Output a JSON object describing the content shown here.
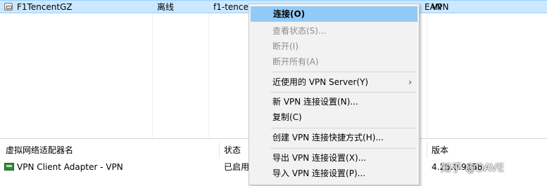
{
  "connection_list": {
    "row": {
      "name": "F1TencentGZ",
      "status": "离线",
      "server": "f1-tence",
      "server_tail": "EAN",
      "type": "VPN"
    }
  },
  "context_menu": {
    "items": [
      {
        "label": "连接(O)",
        "state": "highlighted"
      },
      {
        "label": "查看状态(S)...",
        "state": "disabled"
      },
      {
        "label": "断开(I)",
        "state": "disabled"
      },
      {
        "label": "断开所有(A)",
        "state": "disabled"
      },
      {
        "label": "近使用的 VPN Server(Y)",
        "submenu_arrow": "›"
      },
      {
        "label": "新 VPN 连接设置(N)..."
      },
      {
        "label": "复制(C)"
      },
      {
        "label": "创建 VPN 连接快捷方式(H)..."
      },
      {
        "label": "导出 VPN 连接设置(X)..."
      },
      {
        "label": "导入 VPN 连接设置(P)..."
      }
    ]
  },
  "adapter_list": {
    "headers": {
      "name": "虚拟网络适配器名",
      "status": "状态",
      "version": "版本"
    },
    "row": {
      "name": "VPN Client Adapter - VPN",
      "status": "已启用",
      "version": "4.25.0.9158"
    }
  },
  "watermark": "知乎 @DAVE",
  "colors": {
    "selection": "#cce8ff",
    "menu_highlight": "#91c9f7",
    "menu_bg": "#f2f2f2",
    "disabled_text": "#8c8c8c"
  }
}
